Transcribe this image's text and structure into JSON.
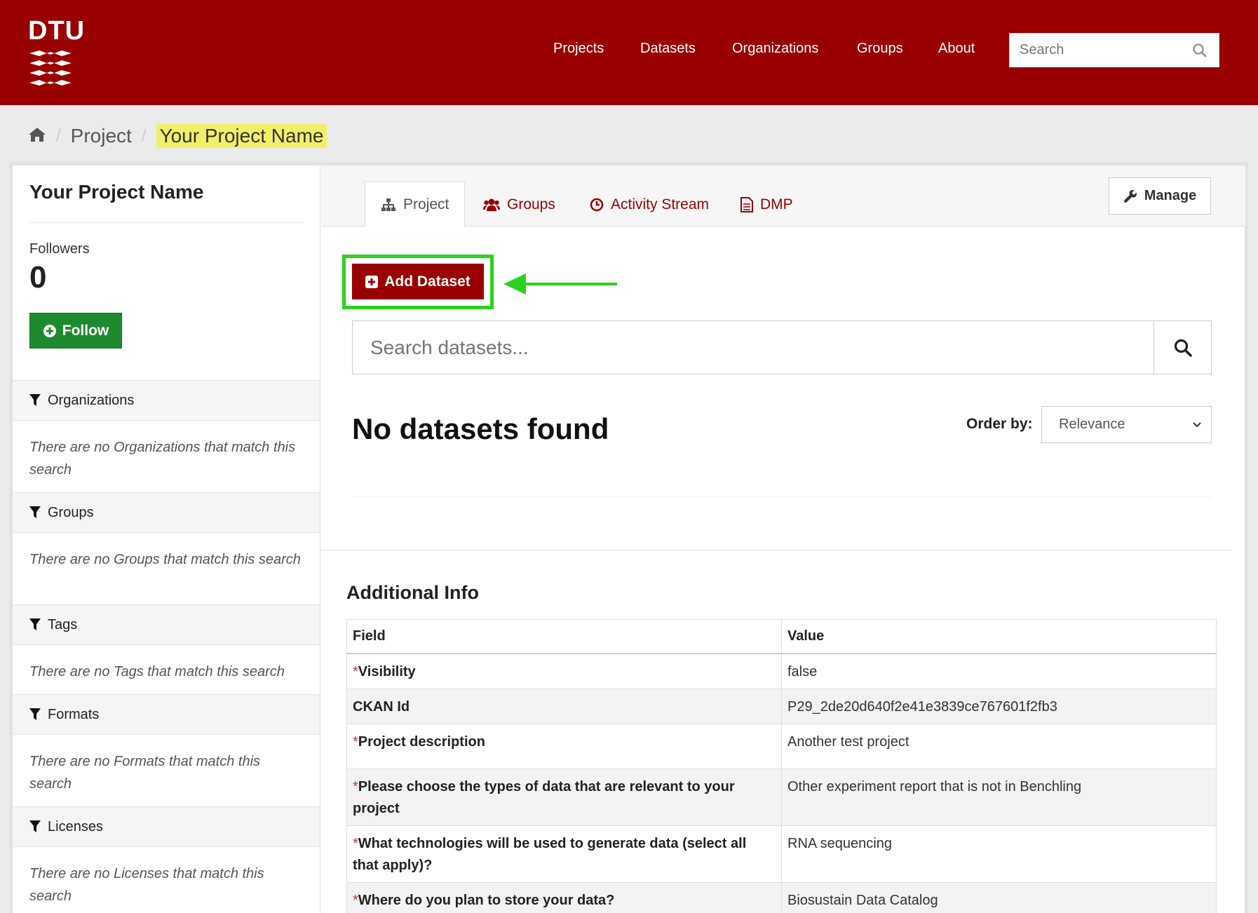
{
  "header": {
    "logo_text": "DTU",
    "nav": [
      {
        "label": "Projects"
      },
      {
        "label": "Datasets"
      },
      {
        "label": "Organizations"
      },
      {
        "label": "Groups"
      },
      {
        "label": "About"
      }
    ],
    "search_placeholder": "Search"
  },
  "breadcrumb": {
    "items": [
      "Project",
      "Your Project Name"
    ]
  },
  "sidebar": {
    "title": "Your Project Name",
    "followers_label": "Followers",
    "followers_count": "0",
    "follow_label": "Follow",
    "facets": [
      {
        "title": "Organizations",
        "empty": "There are no Organizations that match this search"
      },
      {
        "title": "Groups",
        "empty": "There are no Groups that match this search"
      },
      {
        "title": "Tags",
        "empty": "There are no Tags that match this search"
      },
      {
        "title": "Formats",
        "empty": "There are no Formats that match this search"
      },
      {
        "title": "Licenses",
        "empty": "There are no Licenses that match this search"
      }
    ]
  },
  "tabs": [
    {
      "label": "Project",
      "icon": "sitemap-icon",
      "active": true
    },
    {
      "label": "Groups",
      "icon": "users-icon"
    },
    {
      "label": "Activity Stream",
      "icon": "clock-icon"
    },
    {
      "label": "DMP",
      "icon": "document-icon"
    }
  ],
  "manage_label": "Manage",
  "add_dataset_label": "Add Dataset",
  "dataset_search_placeholder": "Search datasets...",
  "results_text": "No datasets found",
  "order_by": {
    "label": "Order by:",
    "selected": "Relevance"
  },
  "additional_info": {
    "title": "Additional Info",
    "headers": [
      "Field",
      "Value"
    ],
    "rows": [
      {
        "field": "Visibility",
        "value": "false",
        "required": true
      },
      {
        "field": "CKAN Id",
        "value": "P29_2de20d640f2e41e3839ce767601f2fb3",
        "required": false
      },
      {
        "field": "Project description",
        "value": "Another test project",
        "required": true
      },
      {
        "field": "Please choose the types of data that are relevant to your project",
        "value": "Other experiment report that is not in Benchling",
        "required": true
      },
      {
        "field": "What technologies will be used to generate data (select all that apply)?",
        "value": "RNA sequencing",
        "required": true
      },
      {
        "field": "Where do you plan to store your data?",
        "value": "Biosustain Data Catalog",
        "required": true
      }
    ]
  },
  "colors": {
    "brand": "#990000",
    "follow": "#1e8a30",
    "highlight": "#2bd21d",
    "breadcrumb_highlight": "#f0f068"
  }
}
